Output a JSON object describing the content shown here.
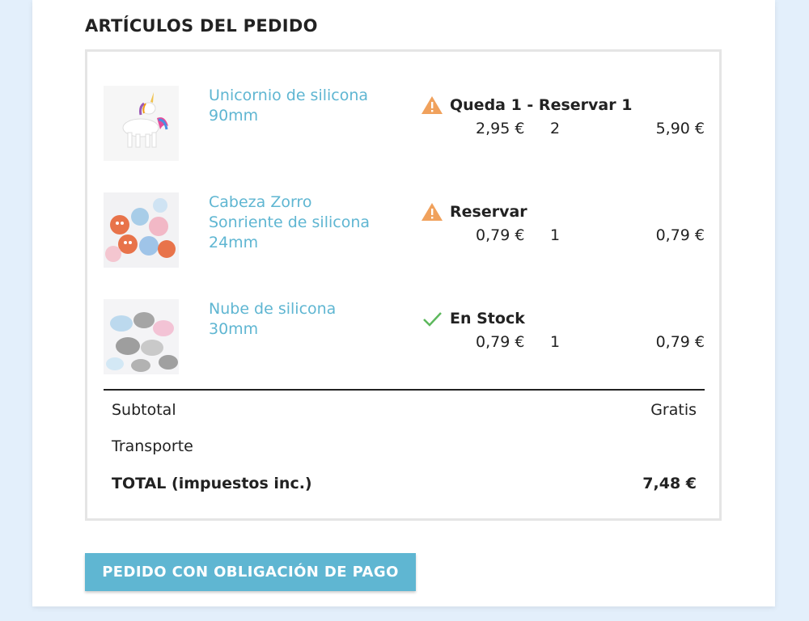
{
  "order": {
    "section_title": "ARTÍCULOS DEL PEDIDO",
    "items": [
      {
        "name": "Unicornio de silicona 90mm",
        "image": "unicorn-image",
        "stock_icon": "warning-icon",
        "stock_status": "Queda 1 - Reservar 1",
        "unit_price": "2,95 €",
        "quantity": "2",
        "line_total": "5,90 €"
      },
      {
        "name": "Cabeza Zorro Sonriente de silicona 24mm",
        "image": "fox-heads-image",
        "stock_icon": "warning-icon",
        "stock_status": "Reservar",
        "unit_price": "0,79 €",
        "quantity": "1",
        "line_total": "0,79 €"
      },
      {
        "name": "Nube de silicona 30mm",
        "image": "clouds-image",
        "stock_icon": "check-icon",
        "stock_status": "En Stock",
        "unit_price": "0,79 €",
        "quantity": "1",
        "line_total": "0,79 €"
      }
    ],
    "summary": {
      "subtotal_label": "Subtotal",
      "subtotal_value": "Gratis",
      "shipping_label": "Transporte",
      "shipping_value": "",
      "total_label": "TOTAL (impuestos inc.)",
      "total_value": "7,48 €"
    },
    "pay_button_label": "PEDIDO CON OBLIGACIÓN DE PAGO"
  },
  "colors": {
    "accent": "#5fb6d2",
    "warning": "#f0a15c",
    "success": "#5cb85c",
    "page_background": "#e3effb"
  }
}
